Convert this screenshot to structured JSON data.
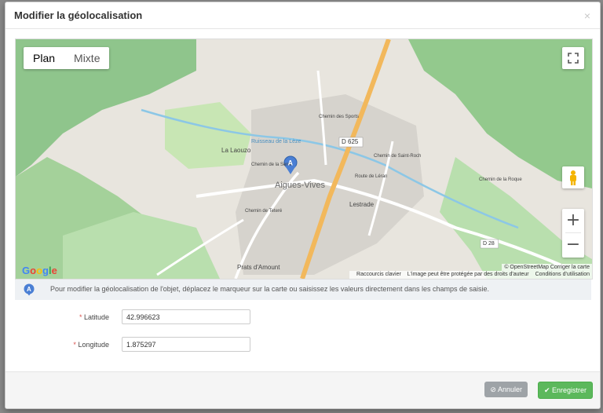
{
  "modal": {
    "title": "Modifier la géolocalisation",
    "close_label": "×"
  },
  "map": {
    "type_options": [
      "Plan",
      "Mixte"
    ],
    "labels": {
      "road1": "D 625",
      "road2": "D 28",
      "village": "Aigues-Vives",
      "place1": "La Laouzo",
      "place2": "Lestrade",
      "place3": "Prats d'Amount",
      "street1": "Chemin de la Serre",
      "street2": "Chemin de Teteré",
      "street3": "Route de Léran",
      "street4": "Chemin des Sports",
      "street5": "Chemin de Saint-Roch",
      "street6": "Chemin de la Roque",
      "stream": "Ruisseau de la Lèze",
      "marker": "A"
    },
    "google_logo": "Google",
    "attribution_osm": "© OpenStreetMap",
    "attribution_fix": "Corriger la carte",
    "attribution_keyboard": "Raccourcis clavier",
    "attribution_image": "L'image peut être protégée par des droits d'auteur",
    "attribution_terms": "Conditions d'utilisation"
  },
  "info": {
    "icon_letter": "A",
    "text": "Pour modifier la géolocalisation de l'objet, déplacez le marqueur sur la carte ou saisissez les valeurs directement dans les champs de saisie."
  },
  "form": {
    "latitude_label": "Latitude",
    "latitude_value": "42.996623",
    "longitude_label": "Longitude",
    "longitude_value": "1.875297",
    "required_mark": "*"
  },
  "footer": {
    "cancel_label": "Annuler",
    "save_label": "Enregistrer"
  },
  "colors": {
    "primary": "#5cb85c",
    "cancel": "#9ea3a7",
    "marker": "#4a7fd4",
    "road_major": "#f2b85c"
  }
}
